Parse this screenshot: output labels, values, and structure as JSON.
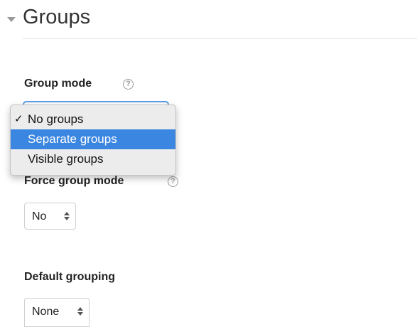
{
  "section": {
    "title": "Groups"
  },
  "group_mode": {
    "label": "Group mode",
    "help": "?",
    "options": [
      "No groups",
      "Separate groups",
      "Visible groups"
    ],
    "checked_option": "No groups",
    "highlighted_option": "Separate groups",
    "check_glyph": "✓"
  },
  "force_group_mode": {
    "label": "Force group mode",
    "help": "?",
    "value": "No"
  },
  "default_grouping": {
    "label": "Default grouping",
    "value": "None"
  },
  "colors": {
    "accent": "#3b86e0",
    "focus_ring": "#5b9ee6"
  }
}
